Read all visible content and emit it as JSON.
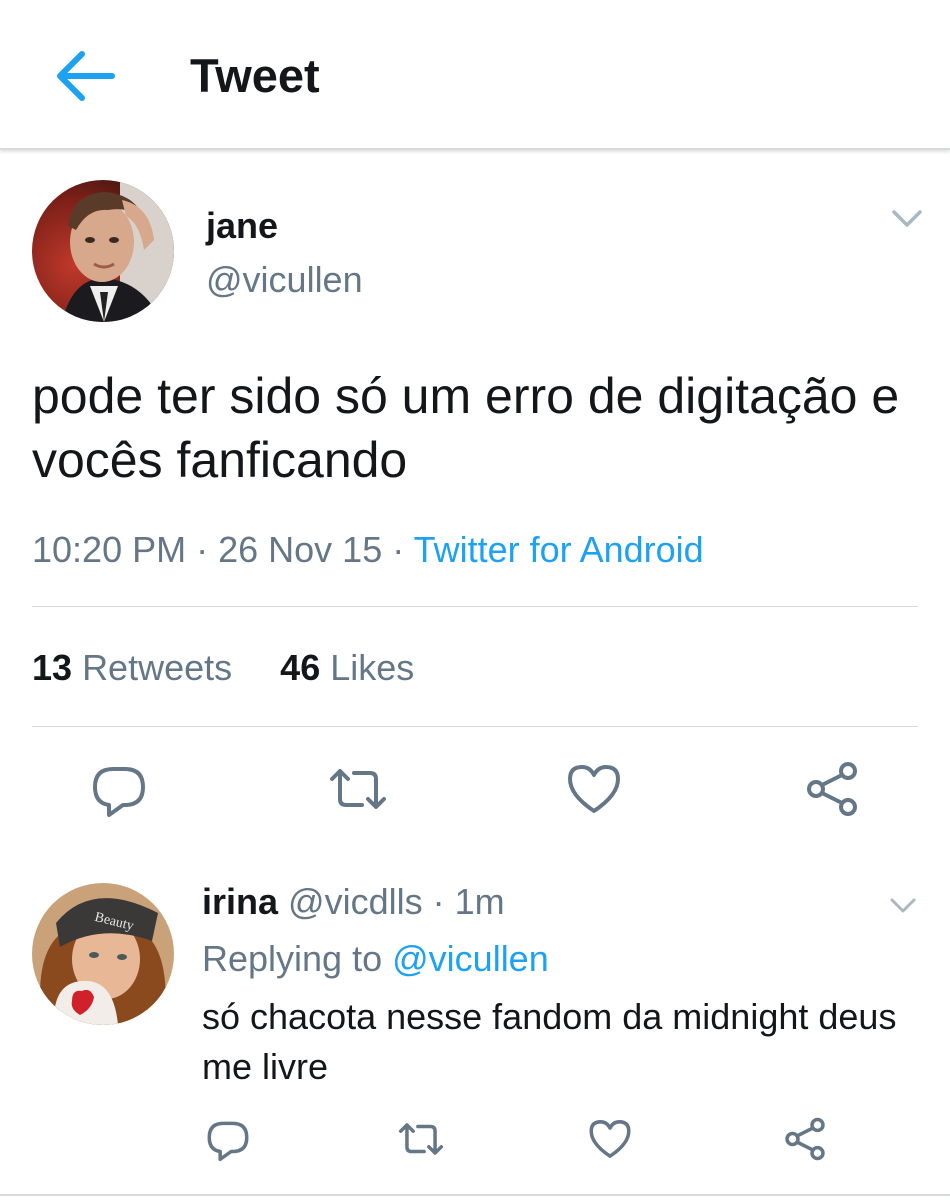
{
  "header": {
    "title": "Tweet"
  },
  "tweet": {
    "author_name": "jane",
    "author_handle": "@vicullen",
    "text": "pode ter sido só um erro de digitação e vocês fanficando",
    "time": "10:20 PM",
    "date": "26 Nov 15",
    "source": "Twitter for Android",
    "retweets_count": "13",
    "retweets_label": "Retweets",
    "likes_count": "46",
    "likes_label": "Likes"
  },
  "reply": {
    "author_name": "irina",
    "author_handle": "@vicdlls",
    "time_ago": "1m",
    "replying_prefix": "Replying to",
    "replying_to": "@vicullen",
    "text": "só chacota nesse fandom da midnight deus me livre"
  },
  "icons": {
    "back": "arrow-left-icon",
    "caret": "chevron-down-icon",
    "reply": "reply-icon",
    "retweet": "retweet-icon",
    "like": "heart-icon",
    "share": "share-icon"
  },
  "colors": {
    "accent": "#1da1f2",
    "text_primary": "#14171a",
    "text_secondary": "#657786",
    "divider": "#d6dbe0"
  }
}
